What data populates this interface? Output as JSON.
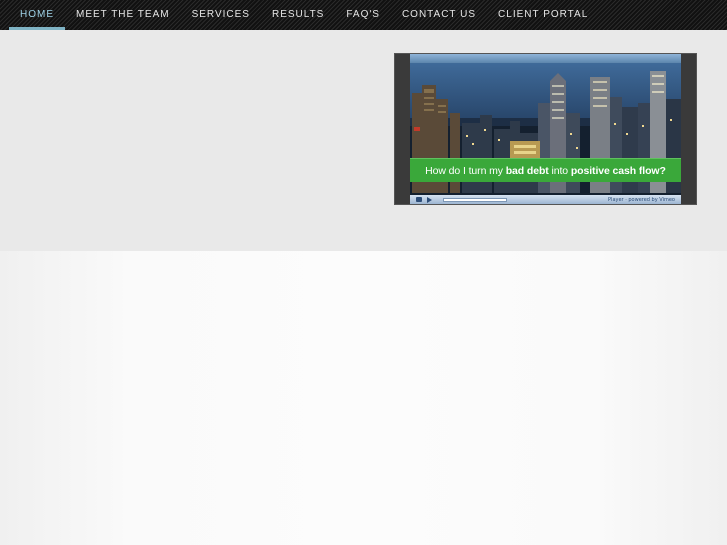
{
  "nav": {
    "items": [
      {
        "label": "HOME",
        "active": true
      },
      {
        "label": "MEET THE TEAM",
        "active": false
      },
      {
        "label": "SERVICES",
        "active": false
      },
      {
        "label": "RESULTS",
        "active": false
      },
      {
        "label": "FAQ'S",
        "active": false
      },
      {
        "label": "CONTACT US",
        "active": false
      },
      {
        "label": "CLIENT PORTAL",
        "active": false
      }
    ]
  },
  "video": {
    "caption_pre": "How do I turn my ",
    "caption_bold1": "bad debt",
    "caption_mid": " into ",
    "caption_bold2": "positive cash flow?",
    "controls_text": "Player · powered by Vimeo"
  },
  "colors": {
    "nav_background": "#151515",
    "nav_active_text": "#9fd3e8",
    "nav_active_underline": "#7fb3c4",
    "caption_background": "#3aa83a",
    "hero_background": "#e9e9e9"
  }
}
